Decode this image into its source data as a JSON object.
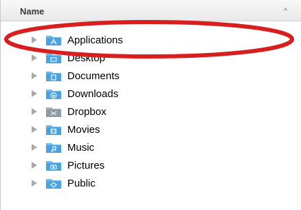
{
  "header": {
    "column_name": "Name",
    "sort_icon": "chevron-up-icon"
  },
  "colors": {
    "folder_blue": "#4aa3df",
    "folder_dark": "#2f86c5",
    "dropbox_folder": "#8e9aa6",
    "annotation_red": "#d81f1f"
  },
  "items": [
    {
      "label": "Applications",
      "icon": "applications-folder-icon"
    },
    {
      "label": "Desktop",
      "icon": "desktop-folder-icon"
    },
    {
      "label": "Documents",
      "icon": "documents-folder-icon"
    },
    {
      "label": "Downloads",
      "icon": "downloads-folder-icon"
    },
    {
      "label": "Dropbox",
      "icon": "dropbox-folder-icon"
    },
    {
      "label": "Movies",
      "icon": "movies-folder-icon"
    },
    {
      "label": "Music",
      "icon": "music-folder-icon"
    },
    {
      "label": "Pictures",
      "icon": "pictures-folder-icon"
    },
    {
      "label": "Public",
      "icon": "public-folder-icon"
    }
  ]
}
